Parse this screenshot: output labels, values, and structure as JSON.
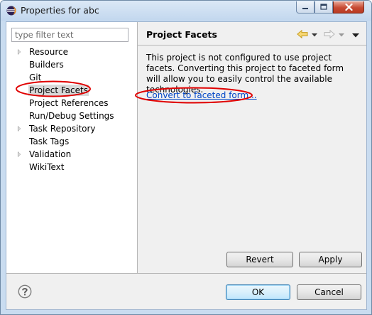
{
  "window": {
    "title": "Properties for abc"
  },
  "filter": {
    "placeholder": "type filter text"
  },
  "tree": {
    "items": [
      {
        "label": "Resource",
        "expandable": true
      },
      {
        "label": "Builders",
        "expandable": false
      },
      {
        "label": "Git",
        "expandable": false
      },
      {
        "label": "Project Facets",
        "expandable": false,
        "selected": true
      },
      {
        "label": "Project References",
        "expandable": false
      },
      {
        "label": "Run/Debug Settings",
        "expandable": false
      },
      {
        "label": "Task Repository",
        "expandable": true
      },
      {
        "label": "Task Tags",
        "expandable": false
      },
      {
        "label": "Validation",
        "expandable": true
      },
      {
        "label": "WikiText",
        "expandable": false
      }
    ]
  },
  "page": {
    "title": "Project Facets",
    "description": "This project is not configured to use project facets. Converting this project to faceted form will allow you to easily control the available technologies.",
    "convert_link": "Convert to faceted form..."
  },
  "buttons": {
    "revert": "Revert",
    "apply": "Apply",
    "ok": "OK",
    "cancel": "Cancel"
  },
  "icons": {
    "app": "eclipse-icon",
    "minimize": "minimize-icon",
    "maximize": "maximize-icon",
    "close": "close-icon",
    "back": "back-arrow-icon",
    "forward": "forward-arrow-icon",
    "view_menu": "view-menu-icon",
    "help": "help-icon"
  },
  "colors": {
    "annotation": "#e00000",
    "link": "#0046c7",
    "close_button": "#c74a33"
  }
}
